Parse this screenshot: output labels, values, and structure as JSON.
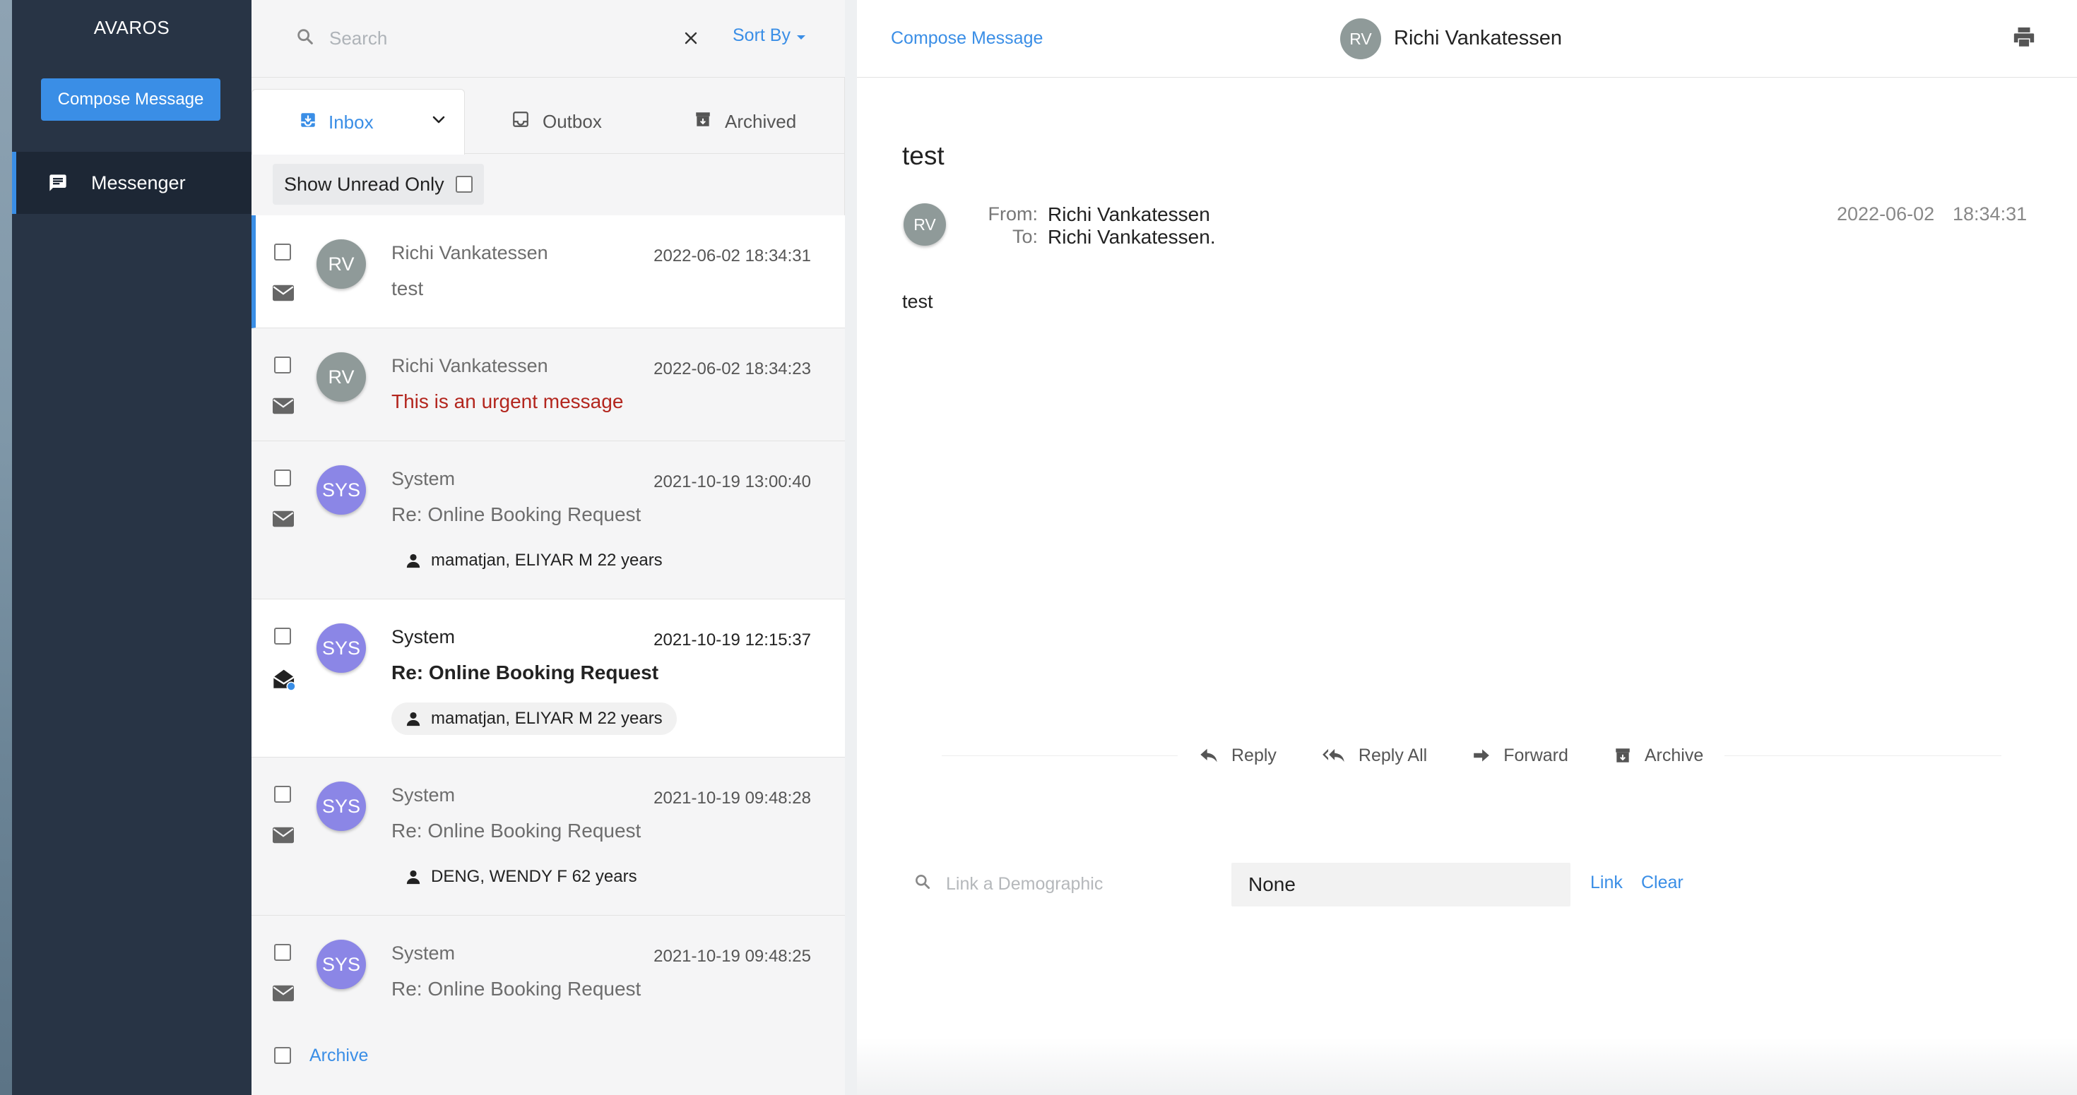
{
  "app": {
    "title": "AVAROS"
  },
  "sidebar": {
    "compose_label": "Compose Message",
    "items": [
      {
        "label": "Messenger",
        "icon": "chat-icon"
      }
    ]
  },
  "list": {
    "search_placeholder": "Search",
    "sort_label": "Sort By",
    "tabs": [
      {
        "label": "Inbox",
        "icon": "inbox-icon"
      },
      {
        "label": "Outbox",
        "icon": "outbox-icon"
      },
      {
        "label": "Archived",
        "icon": "archive-icon"
      }
    ],
    "unread_filter_label": "Show Unread Only",
    "messages": [
      {
        "avatar": "RV",
        "sender": "Richi Vankatessen",
        "date": "2022-06-02 18:34:31",
        "subject": "test",
        "demographic": ""
      },
      {
        "avatar": "RV",
        "sender": "Richi Vankatessen",
        "date": "2022-06-02 18:34:23",
        "subject": "This is an urgent message",
        "demographic": ""
      },
      {
        "avatar": "SYS",
        "sender": "System",
        "date": "2021-10-19 13:00:40",
        "subject": "Re: Online Booking Request",
        "demographic": "mamatjan, ELIYAR M 22 years"
      },
      {
        "avatar": "SYS",
        "sender": "System",
        "date": "2021-10-19 12:15:37",
        "subject": "Re: Online Booking Request",
        "demographic": "mamatjan, ELIYAR M 22 years"
      },
      {
        "avatar": "SYS",
        "sender": "System",
        "date": "2021-10-19 09:48:28",
        "subject": "Re: Online Booking Request",
        "demographic": "DENG, WENDY F 62 years"
      },
      {
        "avatar": "SYS",
        "sender": "System",
        "date": "2021-10-19 09:48:25",
        "subject": "Re: Online Booking Request",
        "demographic": ""
      }
    ],
    "footer_archive_label": "Archive"
  },
  "reader": {
    "compose_label": "Compose Message",
    "header_avatar": "RV",
    "header_name": "Richi Vankatessen",
    "title": "test",
    "avatar": "RV",
    "from_label": "From:",
    "from_value": "Richi Vankatessen",
    "to_label": "To:",
    "to_value": "Richi Vankatessen.",
    "date": "2022-06-02",
    "time": "18:34:31",
    "body": "test",
    "actions": {
      "reply": "Reply",
      "reply_all": "Reply All",
      "forward": "Forward",
      "archive": "Archive"
    },
    "demographic_placeholder": "Link a Demographic",
    "demographic_value": "None",
    "link_label": "Link",
    "clear_label": "Clear"
  },
  "colors": {
    "accent": "#3a8ee6",
    "sidebar_bg": "#283445",
    "urgent": "#b3261e",
    "avatar_rv": "#8f9a99",
    "avatar_sys": "#8b86e6"
  }
}
